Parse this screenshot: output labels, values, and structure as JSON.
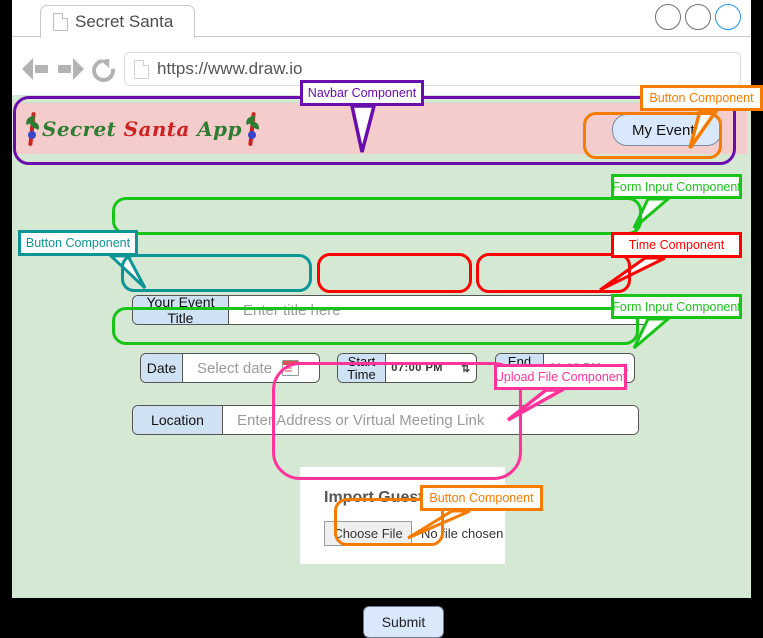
{
  "browser": {
    "tab": {
      "title": "Secret Santa",
      "icon": "page-icon"
    },
    "url": "https://www.draw.io",
    "nav": {
      "back": "back-arrow",
      "forward": "forward-arrow",
      "reload": "reload-icon"
    },
    "window_buttons": [
      "minimize",
      "maximize",
      "close"
    ]
  },
  "navbar": {
    "logo": {
      "word1": "Secret",
      "word2": "Santa",
      "word3": "App"
    },
    "my_events_label": "My Events"
  },
  "form": {
    "title_field": {
      "label": "Your Event Title",
      "placeholder": "Enter title here",
      "value": ""
    },
    "date_field": {
      "label": "Date",
      "placeholder": "Select date",
      "value": "",
      "icon": "calendar-icon"
    },
    "start_time": {
      "label": "Start Time",
      "value": "07:00 PM",
      "spinner": "⇅"
    },
    "end_time": {
      "label": "End Time",
      "value": "10:00 PM",
      "spinner": "⇅"
    },
    "location_field": {
      "label": "Location",
      "placeholder": "Enter Address or Virtual Meeting Link",
      "value": ""
    },
    "upload": {
      "heading": "Import Guest List",
      "choose_label": "Choose File",
      "status": "No file chosen"
    },
    "submit_label": "Submit"
  },
  "annotations": {
    "navbar": {
      "label": "Navbar Component",
      "color": "#6a0dad"
    },
    "my_events": {
      "label": "Button Component",
      "color": "#f57c00"
    },
    "title_input": {
      "label": "Form Input Component",
      "color": "#19c419"
    },
    "date_button": {
      "label": "Button Component",
      "color": "#0d9494"
    },
    "time": {
      "label": "Time Component",
      "color": "#ff0000"
    },
    "location": {
      "label": "Form Input Component",
      "color": "#19c419"
    },
    "upload": {
      "label": "Upload File Component",
      "color": "#ff3399"
    },
    "submit": {
      "label": "Button Component",
      "color": "#f57c00"
    }
  },
  "colors": {
    "page_background": "#d5e8d4",
    "navbar_background": "#f5cccc",
    "field_label_background": "#cfe2f3",
    "button_background": "#dae8fc"
  }
}
